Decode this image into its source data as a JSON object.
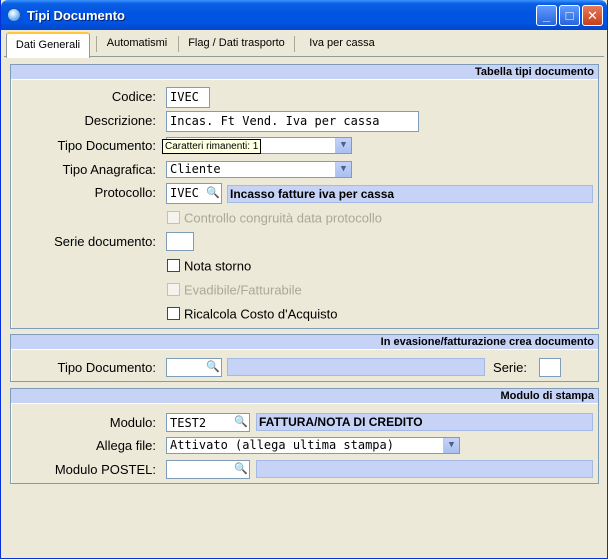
{
  "window": {
    "title": "Tipi Documento",
    "minimize": "_",
    "maximize": "□",
    "close": "✕"
  },
  "tabs": [
    "Dati Generali",
    "Automatismi",
    "Flag / Dati trasporto",
    "Iva per cassa"
  ],
  "section1": {
    "header": "Tabella tipi documento",
    "codice_label": "Codice:",
    "codice_value": "IVEC",
    "descrizione_label": "Descrizione:",
    "descrizione_value": "Incas. Ft Vend. Iva per cassa",
    "tipo_documento_label": "Tipo Documento:",
    "tooltip": "Caratteri rimanenti: 1",
    "tipo_anagrafica_label": "Tipo Anagrafica:",
    "tipo_anagrafica_value": "Cliente",
    "protocollo_label": "Protocollo:",
    "protocollo_value": "IVEC",
    "protocollo_desc": "Incasso fatture iva per cassa",
    "controllo_label": "Controllo congruità data protocollo",
    "serie_label": "Serie documento:",
    "nota_storno_label": "Nota storno",
    "evadibile_label": "Evadibile/Fatturabile",
    "ricalcola_label": "Ricalcola Costo d'Acquisto"
  },
  "section2": {
    "header": "In evasione/fatturazione crea documento",
    "tipo_documento_label": "Tipo Documento:",
    "serie_label": "Serie:"
  },
  "section3": {
    "header": "Modulo di stampa",
    "modulo_label": "Modulo:",
    "modulo_value": "TEST2",
    "modulo_desc": "FATTURA/NOTA DI CREDITO",
    "allega_label": "Allega file:",
    "allega_value": "Attivato (allega ultima stampa)",
    "postel_label": "Modulo POSTEL:"
  },
  "icons": {
    "lookup": "magnifier-icon",
    "dropdown": "chevron-down-icon"
  }
}
